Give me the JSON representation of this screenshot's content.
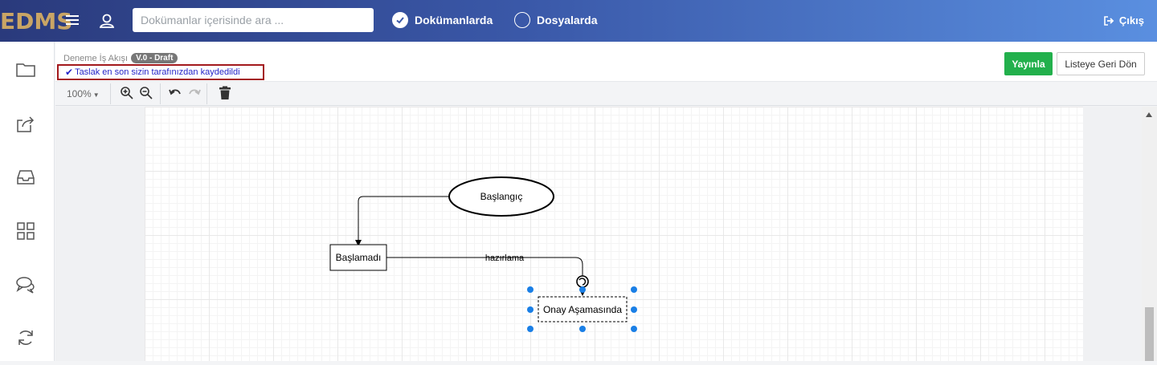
{
  "topbar": {
    "logo": "EDMS",
    "search_placeholder": "Dokümanlar içerisinde ara ...",
    "radio_documents": "Dokümanlarda",
    "radio_folders": "Dosyalarda",
    "logout": "Çıkış"
  },
  "header": {
    "workflow_name": "Deneme İş Akışı",
    "version": "V.0 - Draft",
    "saved_message": "Taslak en son sizin tarafınızdan kaydedildi",
    "publish_button": "Yayınla",
    "back_button": "Listeye Geri Dön"
  },
  "toolbar": {
    "zoom": "100%"
  },
  "diagram": {
    "start_node": "Başlangıç",
    "not_started_node": "Başlamadı",
    "edge_label": "hazırlama",
    "approval_node": "Onay Aşamasında"
  },
  "colors": {
    "topbar_start": "#2a3a7c",
    "topbar_end": "#5a8fe0",
    "publish": "#22b04c",
    "selection": "#1a7fe6",
    "saved_border": "#a3191d"
  },
  "icons": {
    "sidebar": [
      "folder-icon",
      "share-icon",
      "inbox-icon",
      "grid-icon",
      "comments-icon",
      "sync-icon"
    ]
  }
}
